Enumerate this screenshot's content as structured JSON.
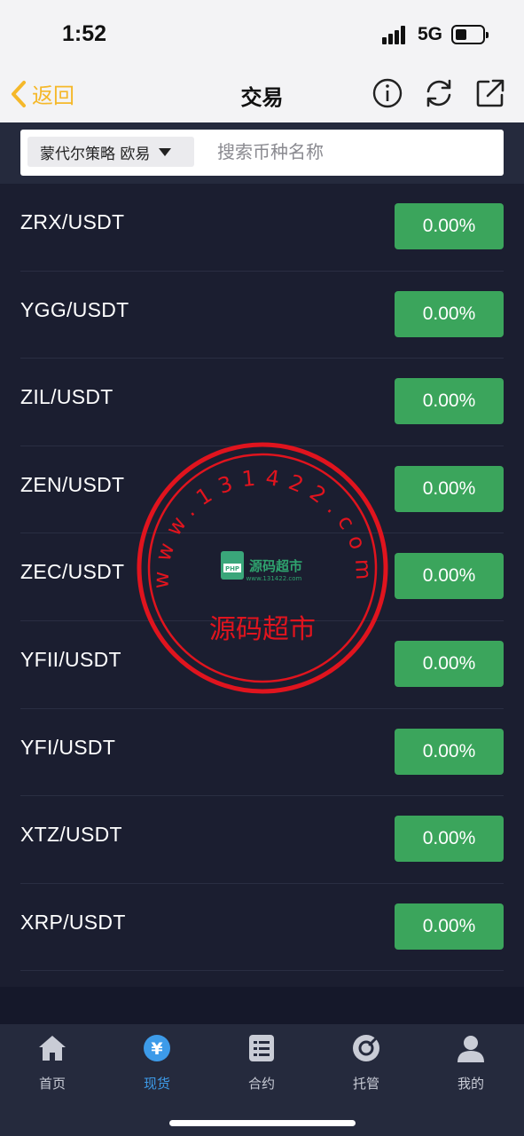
{
  "status_bar": {
    "time": "1:52",
    "network": "5G"
  },
  "nav": {
    "back_label": "返回",
    "title": "交易"
  },
  "search": {
    "exchange": "蒙代尔策略 欧易",
    "placeholder": "搜索币种名称"
  },
  "pairs": [
    {
      "name": "ZRX/USDT",
      "change": "0.00%"
    },
    {
      "name": "YGG/USDT",
      "change": "0.00%"
    },
    {
      "name": "ZIL/USDT",
      "change": "0.00%"
    },
    {
      "name": "ZEN/USDT",
      "change": "0.00%"
    },
    {
      "name": "ZEC/USDT",
      "change": "0.00%"
    },
    {
      "name": "YFII/USDT",
      "change": "0.00%"
    },
    {
      "name": "YFI/USDT",
      "change": "0.00%"
    },
    {
      "name": "XTZ/USDT",
      "change": "0.00%"
    },
    {
      "name": "XRP/USDT",
      "change": "0.00%"
    }
  ],
  "tabs": [
    {
      "label": "首页",
      "icon": "home-icon"
    },
    {
      "label": "现货",
      "icon": "yuan-icon"
    },
    {
      "label": "合约",
      "icon": "list-icon"
    },
    {
      "label": "托管",
      "icon": "vault-icon"
    },
    {
      "label": "我的",
      "icon": "user-icon"
    }
  ],
  "watermark": {
    "arc_text": "www.131422.com",
    "center_text": "源码超市",
    "logo_text": "源码超市",
    "logo_url_text": "www.131422.com",
    "badge_text": "PHP"
  },
  "colors": {
    "accent_gold": "#f5b82a",
    "positive_green": "#3ba55c",
    "active_tab_blue": "#3d9be9",
    "list_background": "#1b1e30",
    "stamp_red": "#e0141e"
  }
}
